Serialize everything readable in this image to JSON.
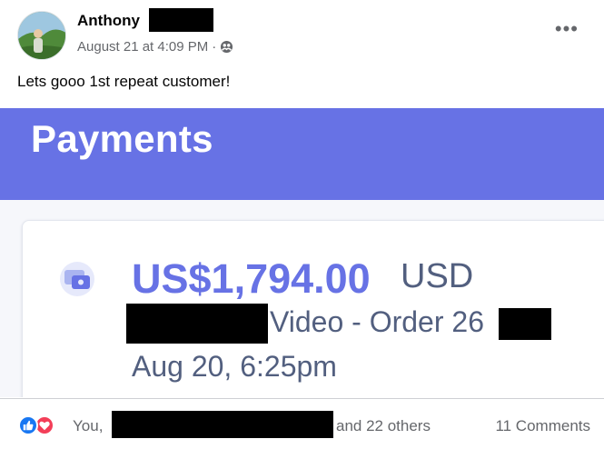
{
  "post": {
    "author": "Anthony",
    "timestamp": "August 21 at 4:09 PM",
    "separator": "·",
    "privacy_icon": "friends-icon",
    "more_icon": "more-options-icon",
    "more_label": "•••",
    "caption": "Lets gooo 1st repeat customer!"
  },
  "screenshot": {
    "banner_title": "Payments",
    "banner_color": "#6772e5",
    "payment_icon": "payment-card-icon",
    "amount": "US$1,794.00",
    "currency": "USD",
    "description": "Video - Order 26",
    "date": "Aug 20, 6:25pm"
  },
  "footer": {
    "reactions": [
      "like-icon",
      "love-icon"
    ],
    "you_label": "You,",
    "others_label": "and 22 others",
    "comments_label": "11 Comments"
  },
  "colors": {
    "facebook_blue": "#1877f2",
    "love_red": "#f33e58",
    "muted_text": "#65676b"
  }
}
